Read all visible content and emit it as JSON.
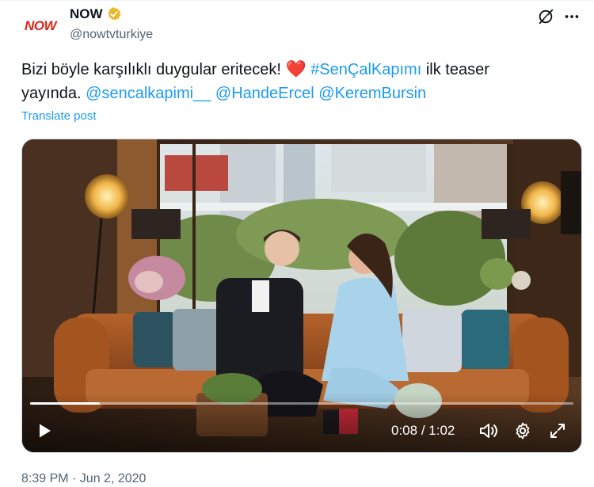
{
  "author": {
    "avatar_text": "NOW",
    "display_name": "NOW",
    "handle": "@nowtvturkiye",
    "verified_badge_icon": "gold-verified-badge-icon"
  },
  "header_actions": {
    "grok_icon": "grok-icon",
    "more_icon": "more-options-icon"
  },
  "tweet": {
    "text_part1": "Bizi böyle karşılıklı duygular eritecek! ",
    "heart_emoji": "❤️",
    "hashtag": "#SenÇalKapımı",
    "text_part2": " ilk teaser",
    "text_part3": "yayında. ",
    "mention1": "@sencalkapimi__",
    "mention2": "@HandeErcel",
    "mention3": "@KeremBursin",
    "translate_label": "Translate post"
  },
  "video": {
    "current_time": "0:08",
    "separator": " / ",
    "duration": "1:02",
    "progress_fraction": 0.129,
    "play_icon": "play-icon",
    "volume_icon": "volume-icon",
    "settings_icon": "settings-gear-icon",
    "fullscreen_icon": "fullscreen-icon"
  },
  "timestamp": "8:39 PM · Jun 2, 2020",
  "colors": {
    "link": "#1d9bf0",
    "text": "#0f1419",
    "secondary": "#536471",
    "brand_red": "#e2231a"
  }
}
